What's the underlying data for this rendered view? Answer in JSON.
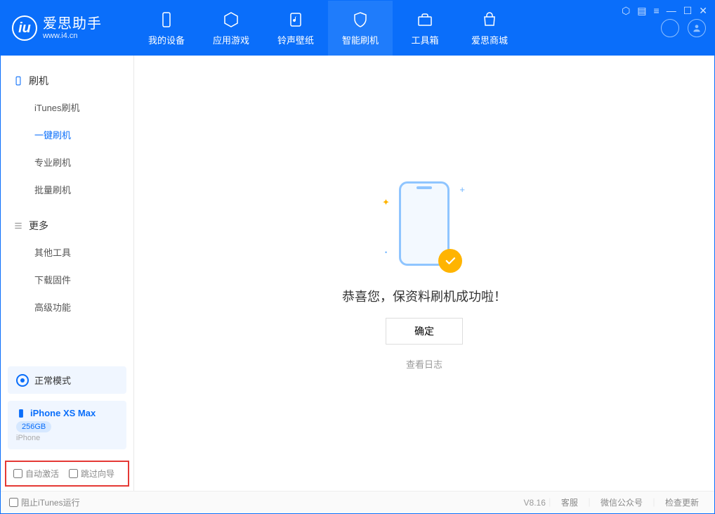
{
  "header": {
    "logo_title": "爱思助手",
    "logo_sub": "www.i4.cn",
    "nav": [
      {
        "label": "我的设备"
      },
      {
        "label": "应用游戏"
      },
      {
        "label": "铃声壁纸"
      },
      {
        "label": "智能刷机"
      },
      {
        "label": "工具箱"
      },
      {
        "label": "爱思商城"
      }
    ]
  },
  "sidebar": {
    "section1_title": "刷机",
    "section1": [
      {
        "label": "iTunes刷机"
      },
      {
        "label": "一键刷机"
      },
      {
        "label": "专业刷机"
      },
      {
        "label": "批量刷机"
      }
    ],
    "section2_title": "更多",
    "section2": [
      {
        "label": "其他工具"
      },
      {
        "label": "下载固件"
      },
      {
        "label": "高级功能"
      }
    ],
    "mode_label": "正常模式",
    "device_name": "iPhone XS Max",
    "device_storage": "256GB",
    "device_type": "iPhone",
    "cb_auto_activate": "自动激活",
    "cb_skip_guide": "跳过向导"
  },
  "main": {
    "success_text": "恭喜您，保资料刷机成功啦！",
    "ok_button": "确定",
    "view_log": "查看日志"
  },
  "footer": {
    "block_itunes": "阻止iTunes运行",
    "version": "V8.16",
    "link_service": "客服",
    "link_wechat": "微信公众号",
    "link_update": "检查更新"
  }
}
